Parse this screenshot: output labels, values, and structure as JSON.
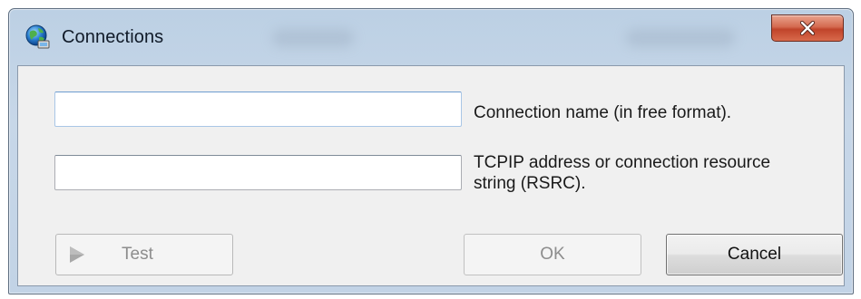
{
  "window": {
    "title": "Connections",
    "icon": "globe-network-icon",
    "close_icon": "close-icon"
  },
  "fields": {
    "connection_name": {
      "value": "",
      "placeholder": "",
      "label": "Connection name (in free format)."
    },
    "address": {
      "value": "",
      "placeholder": "",
      "label": "TCPIP address or connection resource\nstring (RSRC)."
    }
  },
  "buttons": {
    "test": "Test",
    "ok": "OK",
    "cancel": "Cancel"
  },
  "colors": {
    "close_button": "#c9553a",
    "frame": "#c2d3e6",
    "client": "#f0f0f0"
  }
}
